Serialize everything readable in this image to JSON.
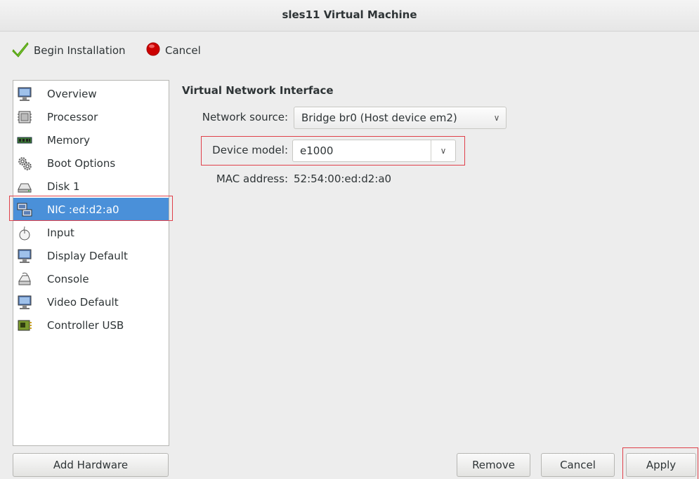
{
  "window": {
    "title": "sles11 Virtual Machine"
  },
  "toolbar": {
    "begin_label": "Begin Installation",
    "cancel_label": "Cancel"
  },
  "sidebar": {
    "items": [
      {
        "label": "Overview",
        "icon": "monitor-icon"
      },
      {
        "label": "Processor",
        "icon": "processor-icon"
      },
      {
        "label": "Memory",
        "icon": "memory-icon"
      },
      {
        "label": "Boot Options",
        "icon": "gears-icon"
      },
      {
        "label": "Disk 1",
        "icon": "disk-icon"
      },
      {
        "label": "NIC :ed:d2:a0",
        "icon": "network-icon",
        "selected": true
      },
      {
        "label": "Input",
        "icon": "mouse-icon"
      },
      {
        "label": "Display Default",
        "icon": "monitor-icon"
      },
      {
        "label": "Console",
        "icon": "console-icon"
      },
      {
        "label": "Video Default",
        "icon": "monitor-icon"
      },
      {
        "label": "Controller USB",
        "icon": "controller-icon"
      }
    ]
  },
  "details": {
    "section_title": "Virtual Network Interface",
    "network_source_label": "Network source:",
    "network_source_value": "Bridge br0 (Host device em2)",
    "device_model_label": "Device model:",
    "device_model_value": "e1000",
    "mac_label": "MAC address:",
    "mac_value": "52:54:00:ed:d2:a0"
  },
  "buttons": {
    "add_hardware": "Add Hardware",
    "remove": "Remove",
    "cancel": "Cancel",
    "apply": "Apply"
  },
  "colors": {
    "selection": "#4a90d9",
    "highlight": "#e0404a"
  }
}
